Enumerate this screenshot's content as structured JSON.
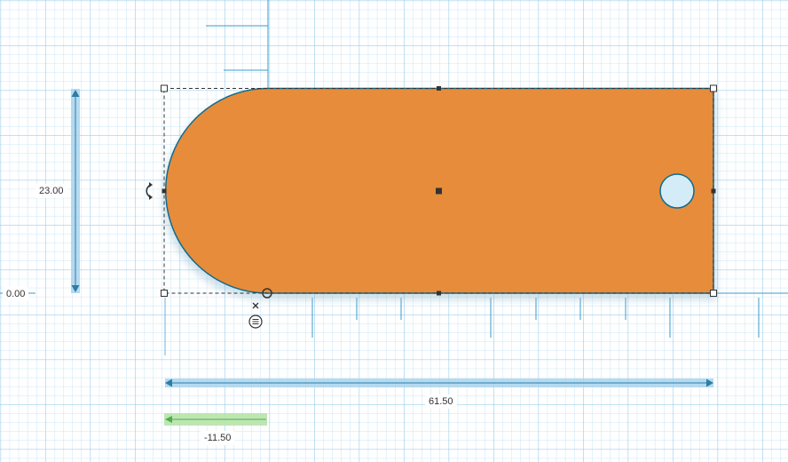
{
  "dimensions": {
    "height": "23.00",
    "elevation": "0.00",
    "width": "61.50",
    "offset": "-11.50"
  },
  "icons": {
    "rotate": "rotate-arrow-icon",
    "close": "close-x-icon",
    "menu": "ruler-menu-icon"
  },
  "colors": {
    "shape_fill": "#E78C3B",
    "shape_outline": "#0E6C8F",
    "grid_minor": "#C8E6F6",
    "grid_major": "#8DC8EA",
    "dimension_bar": "#A9D3EC",
    "dimension_arrow": "#2C7DA8",
    "offset_bar": "#B7E3A8",
    "offset_arrow": "#4CAF50"
  }
}
